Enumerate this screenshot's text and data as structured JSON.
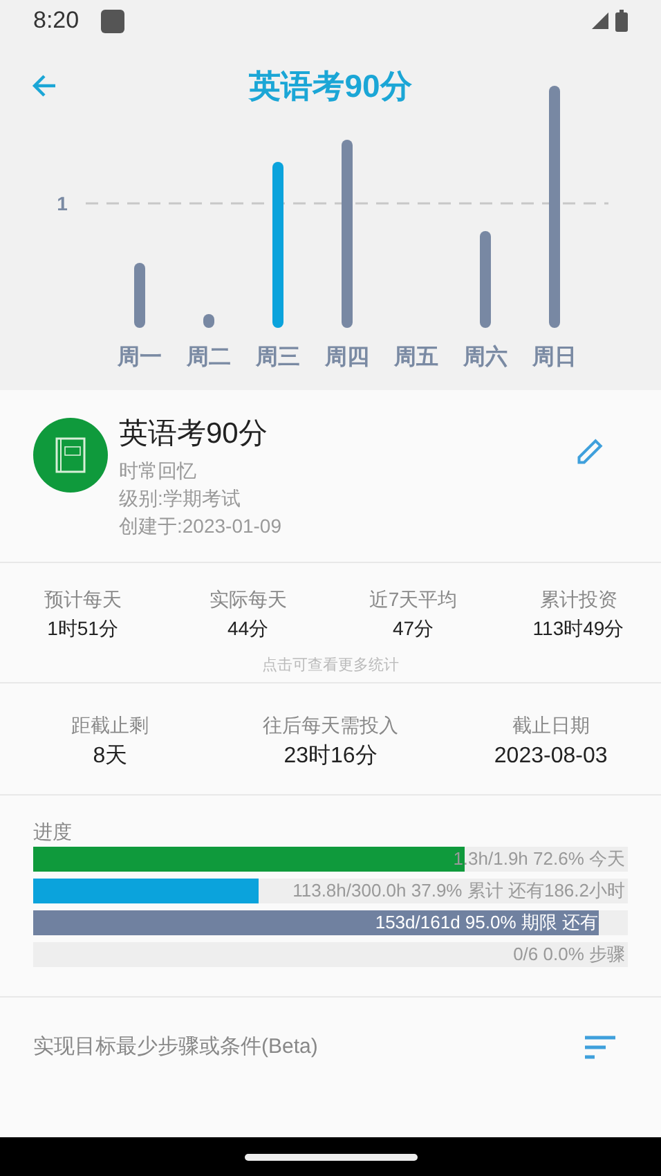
{
  "status_bar": {
    "time": "8:20"
  },
  "header": {
    "title": "英语考90分"
  },
  "chart": {
    "reference_label": "1",
    "days": [
      {
        "label": "周一",
        "selected": false
      },
      {
        "label": "周二",
        "selected": false
      },
      {
        "label": "周三",
        "selected": true
      },
      {
        "label": "周四",
        "selected": false
      },
      {
        "label": "周五"
      },
      {
        "label": "周六",
        "selected": false
      },
      {
        "label": "周日",
        "selected": false
      }
    ]
  },
  "goal": {
    "title": "英语考90分",
    "subtitle": "时常回忆",
    "level_text": "级别:学期考试",
    "created": "创建于:2023-01-09"
  },
  "stats": [
    {
      "label": "预计每天",
      "value": "1时51分"
    },
    {
      "label": "实际每天",
      "value": "44分"
    },
    {
      "label": "近7天平均",
      "value": "47分"
    },
    {
      "label": "累计投资",
      "value": "113时49分"
    }
  ],
  "stats_hint": "点击可查看更多统计",
  "deadline": [
    {
      "label": "距截止剩",
      "value": "8天"
    },
    {
      "label": "往后每天需投入",
      "value": "23时16分"
    },
    {
      "label": "截止日期",
      "value": "2023-08-03"
    }
  ],
  "progress": {
    "title": "进度",
    "bars": [
      {
        "kind": "outside",
        "level": 0.726,
        "color": "#0f9a3c",
        "text": "1.3h/1.9h 72.6% 今天"
      },
      {
        "kind": "outside",
        "level": 0.379,
        "color": "#0ba3dc",
        "text": "113.8h/300.0h 37.9% 累计 还有186.2小时"
      },
      {
        "kind": "inside",
        "level": 0.95,
        "color": "#7081a0",
        "text": "153d/161d 95.0% 期限 还有"
      },
      {
        "kind": "outside",
        "text": "0/6 0.0% 步骤"
      }
    ]
  },
  "steps": {
    "title": "实现目标最少步骤或条件(Beta)"
  }
}
